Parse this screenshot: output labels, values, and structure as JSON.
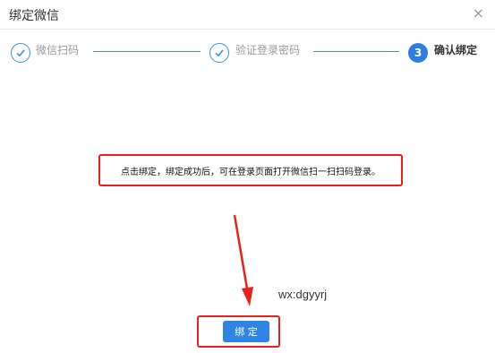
{
  "dialog": {
    "title": "绑定微信",
    "close_label": "×"
  },
  "steps": [
    {
      "number": "1",
      "label": "微信扫码",
      "status": "done"
    },
    {
      "number": "2",
      "label": "验证登录密码",
      "status": "done"
    },
    {
      "number": "3",
      "label": "确认绑定",
      "status": "active"
    }
  ],
  "notice": "点击绑定，绑定成功后，可在登录页面打开微信扫一扫扫码登录。",
  "wechat_id": "wx:dgyyrj",
  "bind_button_label": "绑 定",
  "colors": {
    "accent": "#2d84e5",
    "highlight": "#e8221b"
  }
}
